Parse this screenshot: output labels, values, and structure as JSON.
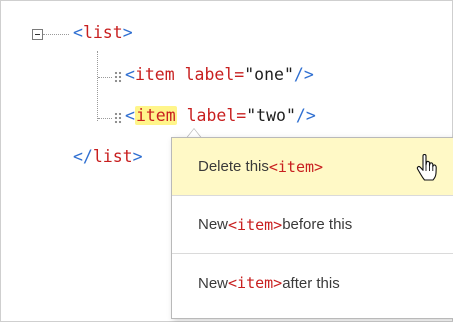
{
  "tree": {
    "list_open": {
      "lt": "<",
      "name": "list",
      "gt": ">"
    },
    "item1": {
      "lt": "<",
      "name": "item",
      "attr": " label=",
      "value": "\"one\"",
      "end": "/>"
    },
    "item2": {
      "lt": "<",
      "name": "item",
      "attr": " label=",
      "value": "\"two\"",
      "end": "/>"
    },
    "list_close": {
      "lt": "</",
      "name": "list",
      "gt": ">"
    }
  },
  "context_menu": {
    "delete": {
      "before": "Delete this ",
      "tag": "<item>",
      "after": ""
    },
    "new_before": {
      "before": "New ",
      "tag": "<item>",
      "after": " before this"
    },
    "new_after": {
      "before": "New ",
      "tag": "<item>",
      "after": " after this"
    }
  },
  "colors": {
    "highlight": "#fff58a",
    "menu_hover": "#fff9c6",
    "tag": "#2f6fd1",
    "name": "#c81f1f"
  }
}
